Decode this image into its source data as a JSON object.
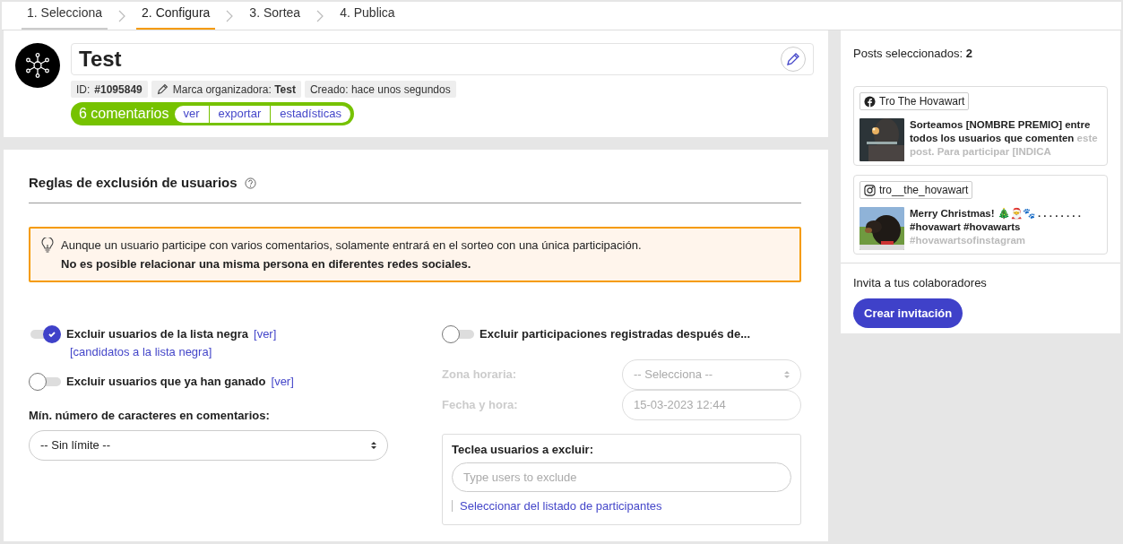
{
  "steps": [
    {
      "label": "1. Selecciona",
      "done": true,
      "selected": false
    },
    {
      "label": "2. Configura",
      "done": false,
      "selected": true
    },
    {
      "label": "3. Sortea",
      "done": false,
      "selected": false
    },
    {
      "label": "4. Publica",
      "done": false,
      "selected": false
    }
  ],
  "giveaway": {
    "title": "Test",
    "badges": [
      {
        "kind": "id",
        "text": "ID: **#1095849**"
      },
      {
        "kind": "brand",
        "text": "Marca organizadora: **Test**"
      },
      {
        "kind": "plain",
        "text": "Creado: hace unos segundos"
      }
    ],
    "comments": {
      "count": "6 comentarios",
      "links": [
        "ver",
        "exportar",
        "estadísticas"
      ]
    }
  },
  "rules": {
    "title": "Reglas de exclusión de usuarios",
    "notice": [
      "Aunque un usuario participe con varios comentarios, solamente entrará en el sorteo con una única participación.",
      "No es posible relacionar una misma persona en diferentes redes sociales."
    ],
    "toggles": [
      {
        "label": "Excluir usuarios de la lista negra",
        "on": true,
        "links": [
          "[ver]"
        ],
        "sublink": "[candidatos a la lista negra]"
      },
      {
        "label": "Excluir usuarios que ya han ganado",
        "on": false,
        "links": [
          "[ver]"
        ]
      }
    ],
    "min_chars": {
      "label": "Mín. número de caracteres en comentarios:",
      "value": "-- Sin límite --"
    },
    "date_toggle": {
      "label": "Excluir participaciones registradas después de...",
      "on": false
    },
    "fields": [
      {
        "kind": "select",
        "label": "Zona horaria:",
        "value": "-- Selecciona --",
        "disabled": true
      },
      {
        "kind": "input",
        "label": "Fecha y hora:",
        "value": "15-03-2023 12:44",
        "disabled": true
      }
    ],
    "exclude_box": {
      "label": "Teclea usuarios a excluir:",
      "placeholder": "Type users to exclude",
      "link": "Seleccionar del listado de participantes"
    }
  },
  "sidebar": {
    "posts_label": "Posts seleccionados: **2**",
    "posts": [
      {
        "kind": "facebook",
        "account": "Tro The Hovawart",
        "text": "Sorteamos [NOMBRE PREMIO] entre todos los usuarios que comenten",
        "faded": "este post. Para participar [INDICA"
      },
      {
        "kind": "instagram",
        "account": "tro__the_hovawart",
        "text": "Merry Christmas! 🎄🎅🐾 . . . . . . . . #hovawart #hovawarts",
        "faded": "#hovawartsofinstagram"
      }
    ],
    "invite_label": "Invita a tus colaboradores",
    "invite_button": "Crear invitación"
  }
}
